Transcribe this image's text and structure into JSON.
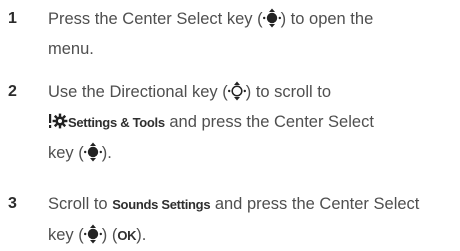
{
  "steps": [
    {
      "number": "1",
      "line1": {
        "before": "Press the Center Select key (",
        "after": ") to open the"
      },
      "line2": "menu.",
      "icon": "center-select-key-icon"
    },
    {
      "number": "2",
      "line1": {
        "before": "Use the Directional key (",
        "after": ") to scroll to"
      },
      "icons": [
        "directional-key-icon",
        "settings-tools-icon",
        "center-select-key-icon"
      ],
      "menu_item": "Settings & Tools",
      "line2_after": " and press the Center Select",
      "line3": {
        "before": "key (",
        "after": ")."
      }
    },
    {
      "number": "3",
      "line1": {
        "before": "Scroll to ",
        "after": " and press the Center Select"
      },
      "menu_item": "Sounds Settings",
      "line2": {
        "before": "key (",
        "middle": ") (",
        "after": ")."
      },
      "softkey": "OK",
      "icon": "center-select-key-icon"
    }
  ]
}
